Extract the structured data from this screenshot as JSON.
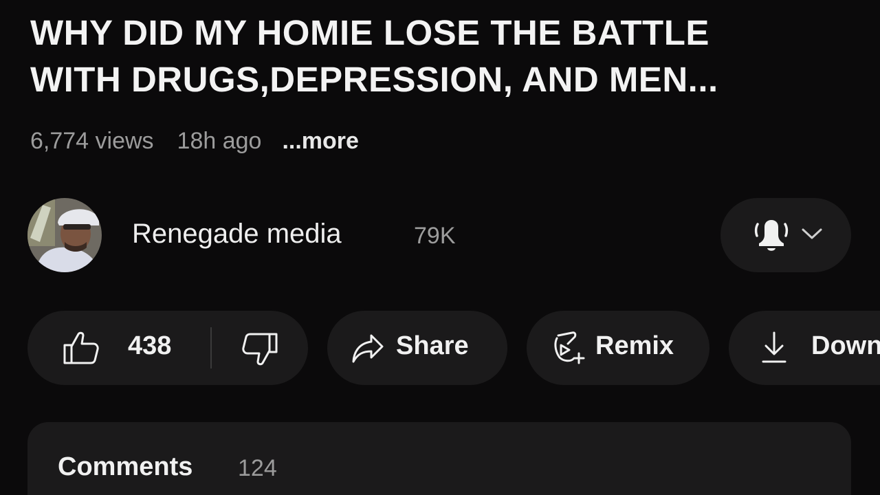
{
  "video": {
    "title_line1": "WHY DID MY HOMIE LOSE THE BATTLE",
    "title_line2": "WITH DRUGS,DEPRESSION, AND MEN...",
    "views": "6,774 views",
    "posted": "18h ago",
    "more_label": "...more"
  },
  "channel": {
    "name": "Renegade media",
    "subscribers": "79K",
    "bell_icon": "bell-icon",
    "chevron_icon": "chevron-down-icon"
  },
  "actions": {
    "like_count": "438",
    "like_icon": "thumbs-up-icon",
    "dislike_icon": "thumbs-down-icon",
    "share_label": "Share",
    "share_icon": "share-arrow-icon",
    "remix_label": "Remix",
    "remix_icon": "remix-icon",
    "download_label": "Download",
    "download_icon": "download-icon"
  },
  "comments": {
    "label": "Comments",
    "count": "124"
  },
  "colors": {
    "background": "#0b0a0b",
    "pill": "#1b1a1b",
    "text_primary": "#f1f1f1",
    "text_secondary": "#9c9c9c"
  }
}
